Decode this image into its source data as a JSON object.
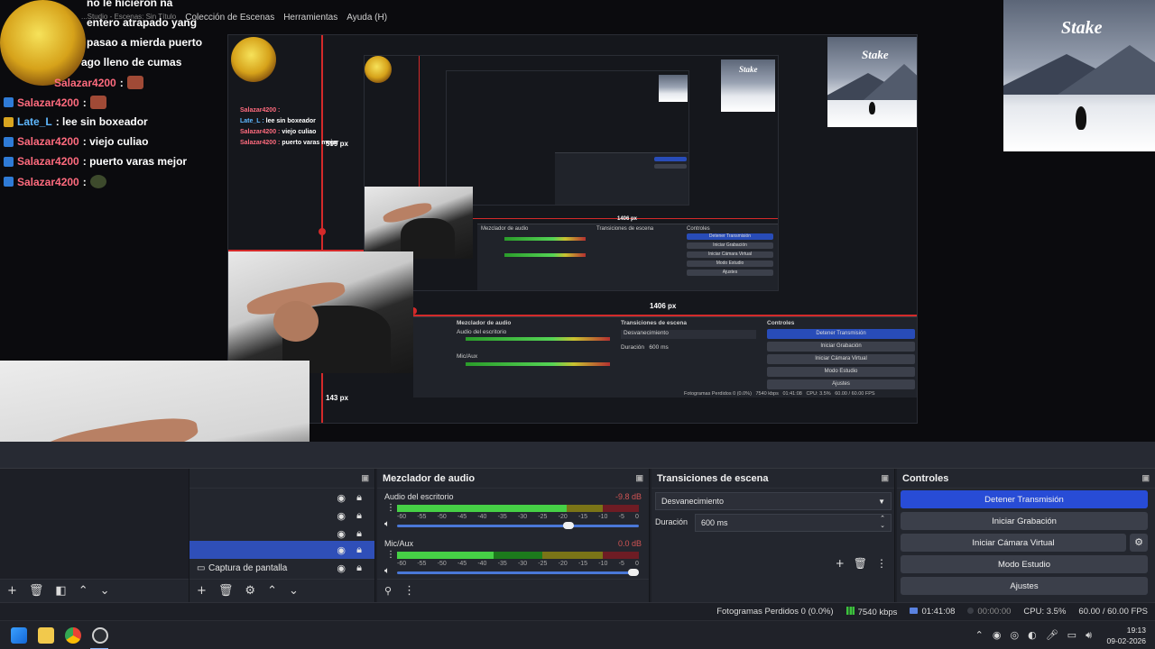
{
  "menu": {
    "app_line": "...Studio - Escenas: Sin Título",
    "items": [
      "Colección de Escenas",
      "Herramientas",
      "Ayuda (H)"
    ]
  },
  "chat": [
    {
      "user": "",
      "msg": "no le hicieron na",
      "badge": "",
      "emote": false
    },
    {
      "user": "",
      "msg": "entero atrapado yang",
      "badge": "",
      "emote": false
    },
    {
      "user": "",
      "msg": "pasao a mierda puerto",
      "badge": "",
      "emote": false
    },
    {
      "user": "",
      "msg": "ago lleno de cumas",
      "badge": "",
      "emote": false
    },
    {
      "user": "Salazar4200",
      "msg": ":",
      "badge": "blue",
      "emote": true
    },
    {
      "user": "Salazar4200",
      "msg": ":",
      "badge": "blue",
      "emote": true
    },
    {
      "user": "Late_L",
      "msg": ": lee sin boxeador",
      "badge": "gold",
      "emote": false
    },
    {
      "user": "Salazar4200",
      "msg": ": viejo culiao",
      "badge": "blue",
      "emote": false
    },
    {
      "user": "Salazar4200",
      "msg": ": puerto varas mejor",
      "badge": "blue",
      "emote": false
    },
    {
      "user": "Salazar4200",
      "msg": ":",
      "badge": "blue",
      "emote": true
    }
  ],
  "nested_labels": {
    "w_1406": "1406 px",
    "h_143": "143 px",
    "h_599": "599 px",
    "mini_1406": "1406 px"
  },
  "stake": {
    "logo": "Stake"
  },
  "docks": {
    "mixer": {
      "title": "Mezclador de audio",
      "channels": [
        {
          "name": "Audio del escritorio",
          "db": "-9.8 dB",
          "level": 0.7,
          "volume": 0.73
        },
        {
          "name": "Mic/Aux",
          "db": "0.0 dB",
          "level": 0.4,
          "volume": 1.0
        }
      ],
      "scale": [
        "-60",
        "-55",
        "-50",
        "-45",
        "-40",
        "-35",
        "-30",
        "-25",
        "-20",
        "-15",
        "-10",
        "-5",
        "0"
      ]
    },
    "transitions": {
      "title": "Transiciones de escena",
      "selected": "Desvanecimiento",
      "duration_label": "Duración",
      "duration_value": "600 ms"
    },
    "controls": {
      "title": "Controles",
      "buttons": [
        "Detener Transmisión",
        "Iniciar Grabación",
        "Iniciar Cámara Virtual",
        "Modo Estudio",
        "Ajustes"
      ]
    },
    "sources": {
      "items": [
        "",
        "",
        "",
        "",
        "Captura de pantalla"
      ]
    }
  },
  "status": {
    "dropped": "Fotogramas Perdidos 0 (0.0%)",
    "bitrate": "7540 kbps",
    "stream_time": "01:41:08",
    "rec_time": "00:00:00",
    "cpu": "CPU: 3.5%",
    "fps": "60.00 / 60.00 FPS"
  },
  "taskbar": {
    "time": "19:13",
    "date": "09-02-2026"
  }
}
